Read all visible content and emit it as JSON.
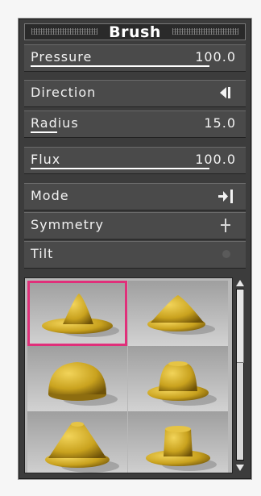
{
  "panel": {
    "title": "Brush"
  },
  "rows": [
    {
      "label": "Pressure",
      "value": "100.0",
      "level": 1.0
    },
    {
      "label": "Direction",
      "icon": "direction-arrow-icon"
    },
    {
      "label": "Radius",
      "value": "15.0",
      "level": 0.15
    },
    {
      "label": "Flux",
      "value": "100.0",
      "level": 1.0
    },
    {
      "label": "Mode",
      "icon": "mode-arrow-bar-icon"
    },
    {
      "label": "Symmetry",
      "icon": "symmetry-cross-icon"
    },
    {
      "label": "Tilt",
      "icon": "tilt-dot-icon"
    }
  ],
  "presets": [
    {
      "name": "cone-wide-brim",
      "selected": true
    },
    {
      "name": "cone-small-brim",
      "selected": false
    },
    {
      "name": "dome",
      "selected": false
    },
    {
      "name": "bell",
      "selected": false
    },
    {
      "name": "flat-top-cone",
      "selected": false
    },
    {
      "name": "cylinder-brim",
      "selected": false
    }
  ],
  "colors": {
    "selection": "#e0307a",
    "gold": "#c9a21e"
  }
}
